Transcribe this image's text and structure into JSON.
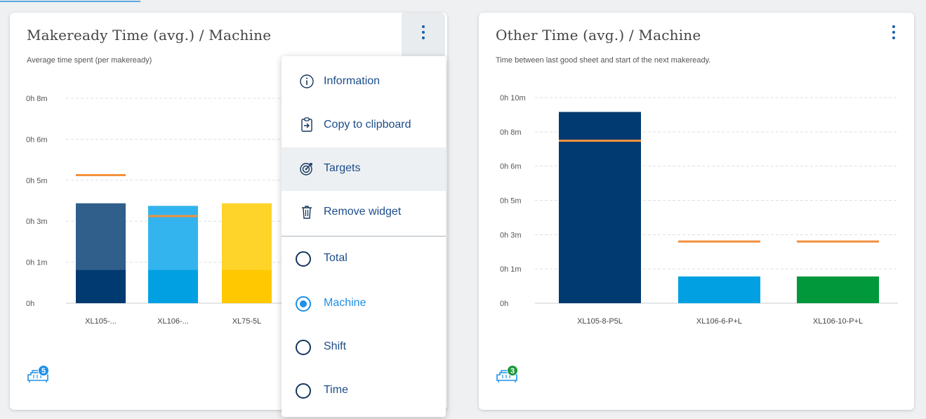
{
  "colors": {
    "accent": "#1e90e8",
    "brand_blue": "#1b5fa8",
    "target_line": "#f2913d",
    "dark_navy": "#003a70",
    "navy_upper": "#2f5f8a",
    "sky_upper": "#33b4ee",
    "sky_lower": "#00a0e3",
    "yellow_upper": "#ffd42a",
    "yellow_lower": "#ffc800",
    "green": "#00983a"
  },
  "card1": {
    "title": "Makeready Time (avg.) / Machine",
    "subtitle": "Average time spent (per makeready)",
    "menu_icon": "kebab-vertical-icon",
    "badge_count": "5",
    "machine_icon": "press-machine-icon"
  },
  "card2": {
    "title": "Other Time (avg.) / Machine",
    "subtitle": "Time between last good sheet and start of the next makeready.",
    "menu_icon": "kebab-vertical-icon",
    "badge_count": "3",
    "machine_icon": "press-machine-icon"
  },
  "menu": {
    "actions": [
      {
        "label": "Information",
        "icon": "info-circle-icon"
      },
      {
        "label": "Copy to clipboard",
        "icon": "clipboard-copy-icon"
      },
      {
        "label": "Targets",
        "icon": "target-icon",
        "highlighted": true
      },
      {
        "label": "Remove widget",
        "icon": "trash-icon"
      }
    ],
    "views": [
      {
        "label": "Total",
        "selected": false
      },
      {
        "label": "Machine",
        "selected": true
      },
      {
        "label": "Shift",
        "selected": false
      },
      {
        "label": "Time",
        "selected": false
      }
    ]
  },
  "chart_data": [
    {
      "type": "bar",
      "stacked": true,
      "grid": true,
      "yticks": [
        "0h",
        "0h 1m",
        "0h 3m",
        "0h 5m",
        "0h 6m",
        "0h 8m"
      ],
      "ylim": [
        0,
        8
      ],
      "categories": [
        "XL105-...",
        "XL106-...",
        "XL75-5L"
      ],
      "series": [
        {
          "values": [
            1.3,
            1.3,
            1.3
          ]
        },
        {
          "values": [
            2.6,
            2.5,
            2.6
          ]
        }
      ],
      "totals": [
        3.9,
        3.8,
        3.9
      ],
      "targets": [
        5.0,
        3.4,
        null
      ]
    },
    {
      "type": "bar",
      "grid": true,
      "yticks": [
        "0h",
        "0h 1m",
        "0h 3m",
        "0h 5m",
        "0h 6m",
        "0h 8m",
        "0h 10m"
      ],
      "ylim": [
        0,
        10
      ],
      "categories": [
        "XL105-8-P5L",
        "XL106-6-P+L",
        "XL106-10-P+L"
      ],
      "values": [
        9.3,
        1.3,
        1.3
      ],
      "targets": [
        7.9,
        3.0,
        3.0
      ]
    }
  ]
}
